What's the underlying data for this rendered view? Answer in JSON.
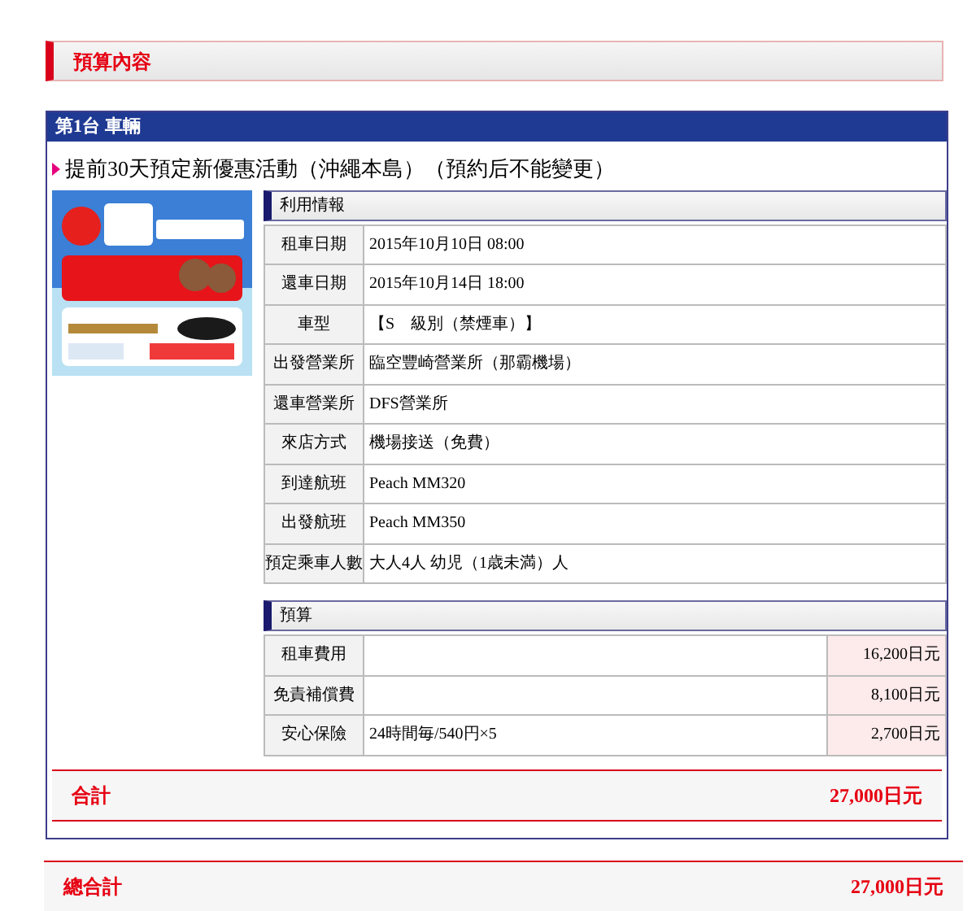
{
  "section_title": "預算內容",
  "vehicle": {
    "header": "第1台 車輛",
    "plan_title": "提前30天預定新優惠活動（沖繩本島）（預約后不能變更）",
    "usage_info": {
      "title": "利用情報",
      "rows": [
        {
          "label": "租車日期",
          "value": "2015年10月10日 08:00"
        },
        {
          "label": "還車日期",
          "value": "2015年10月14日 18:00"
        },
        {
          "label": "車型",
          "value": "【S　級別（禁煙車）】"
        },
        {
          "label": "出發營業所",
          "value": "臨空豐崎營業所（那霸機場）"
        },
        {
          "label": "還車營業所",
          "value": "DFS營業所"
        },
        {
          "label": "來店方式",
          "value": "機場接送（免費）"
        },
        {
          "label": "到達航班",
          "value": "Peach MM320"
        },
        {
          "label": "出發航班",
          "value": "Peach MM350"
        },
        {
          "label": "預定乘車人數",
          "value": "大人4人 幼児（1歳未満）人"
        }
      ]
    },
    "budget": {
      "title": "預算",
      "rows": [
        {
          "label": "租車費用",
          "detail": "",
          "amount": "16,200日元"
        },
        {
          "label": "免責補償費",
          "detail": "",
          "amount": "8,100日元"
        },
        {
          "label": "安心保險",
          "detail": "24時間毎/540円×5",
          "amount": "2,700日元"
        }
      ]
    },
    "subtotal": {
      "label": "合計",
      "amount": "27,000日元"
    }
  },
  "grand_total": {
    "label": "總合計",
    "amount": "27,000日元"
  }
}
